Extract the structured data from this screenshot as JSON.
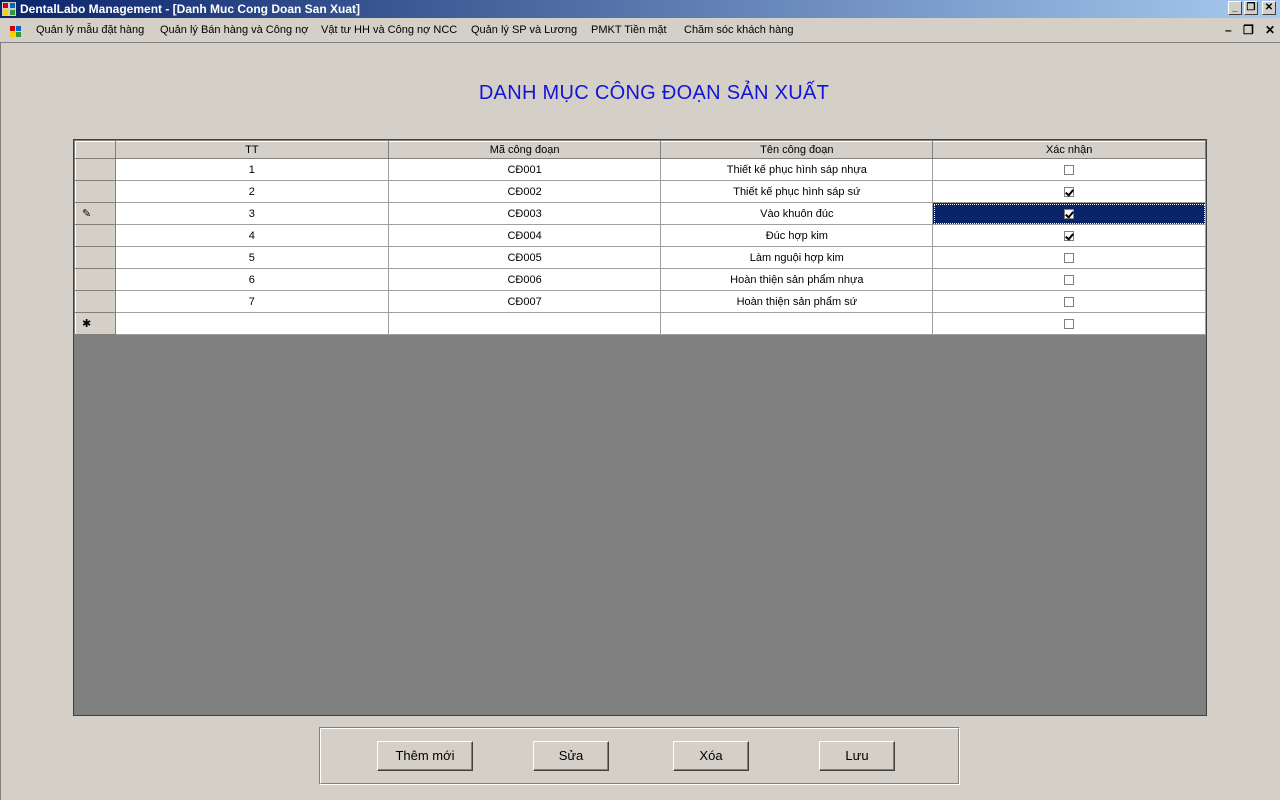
{
  "window": {
    "title": "DentalLabo Management - [Danh Muc Cong Doan San Xuat]",
    "controls": {
      "minimize": "_",
      "restore": "❐",
      "close": "✕"
    }
  },
  "menu": {
    "items": [
      "Quản lý mẫu đặt hàng",
      "Quản lý Bán hàng và Công nợ",
      "Vật tư HH và Công nợ NCC",
      "Quản lý SP và Lương",
      "PMKT Tiền mặt",
      "Chăm sóc khách hàng"
    ],
    "mdi_controls": {
      "minimize": "–",
      "restore": "❐",
      "close": "✕"
    }
  },
  "heading": "DANH MỤC CÔNG ĐOẠN SẢN XUẤT",
  "grid": {
    "columns": [
      "TT",
      "Mã công đoạn",
      "Tên công đoạn",
      "Xác nhận"
    ],
    "rows": [
      {
        "tt": "1",
        "ma": "CĐ001",
        "ten": "Thiết kế phục hình sáp nhựa",
        "xacnhan": false
      },
      {
        "tt": "2",
        "ma": "CĐ002",
        "ten": "Thiết kế phục hình sáp sứ",
        "xacnhan": true
      },
      {
        "tt": "3",
        "ma": "CĐ003",
        "ten": "Vào khuôn đúc",
        "xacnhan": true
      },
      {
        "tt": "4",
        "ma": "CĐ004",
        "ten": "Đúc hợp kim",
        "xacnhan": true
      },
      {
        "tt": "5",
        "ma": "CĐ005",
        "ten": "Làm nguội hợp kim",
        "xacnhan": false
      },
      {
        "tt": "6",
        "ma": "CĐ006",
        "ten": "Hoàn thiện sản phẩm nhựa",
        "xacnhan": false
      },
      {
        "tt": "7",
        "ma": "CĐ007",
        "ten": "Hoàn thiện sản phẩm sứ",
        "xacnhan": false
      }
    ],
    "selected_row": 2,
    "editing_marker": "✎",
    "new_row_marker": "✱",
    "new_row_checked": false
  },
  "buttons": {
    "add": "Thêm mới",
    "edit": "Sửa",
    "delete": "Xóa",
    "save": "Lưu"
  },
  "colors": {
    "heading": "#1414d8",
    "selection": "#0a246a",
    "titlebar": "#0a246a",
    "grid_background": "#808080"
  }
}
